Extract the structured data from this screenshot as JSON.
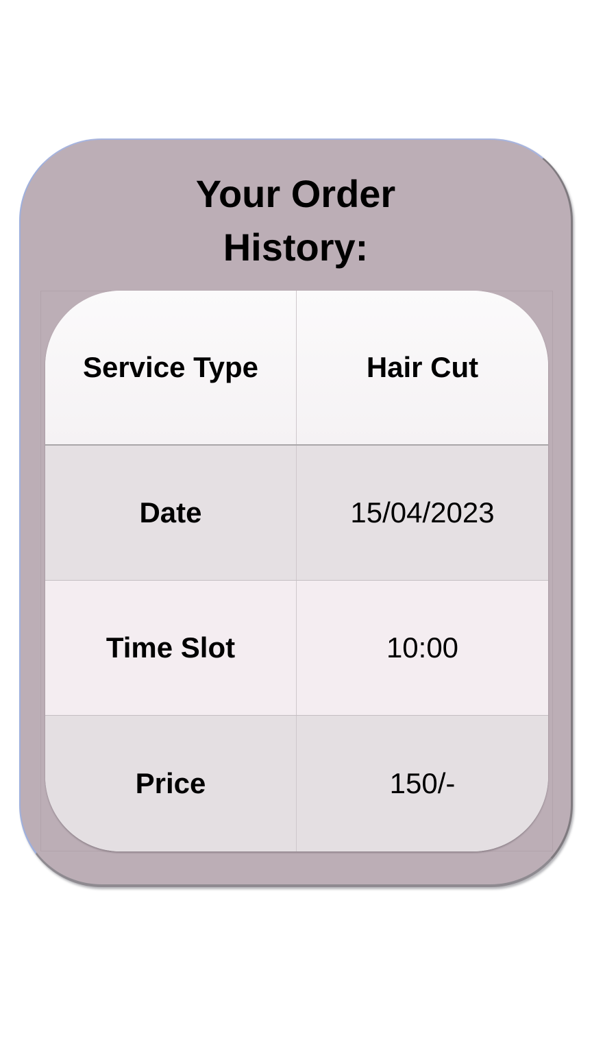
{
  "title": {
    "line1": "Your Order",
    "line2": "History:"
  },
  "order": {
    "rows": [
      {
        "label": "Service Type",
        "value": "Hair Cut"
      },
      {
        "label": "Date",
        "value": "15/04/2023"
      },
      {
        "label": "Time Slot",
        "value": "10:00"
      },
      {
        "label": "Price",
        "value": "150/-"
      }
    ]
  },
  "colors": {
    "card_background": "#bcaeb6",
    "table_header_background": "#f8f6f7",
    "table_row_alt_background": "#e5e0e3"
  }
}
